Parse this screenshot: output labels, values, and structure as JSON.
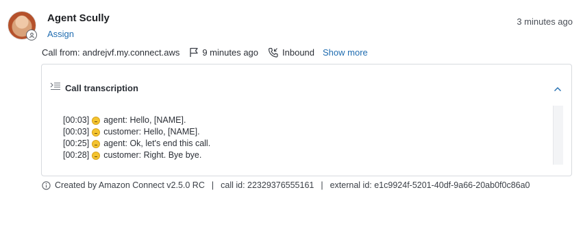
{
  "header": {
    "agent_name": "Agent Scully",
    "assign_label": "Assign",
    "time_ago": "3 minutes ago"
  },
  "meta": {
    "call_from": "Call from: andrejvf.my.connect.aws",
    "duration": "9 minutes ago",
    "direction": "Inbound",
    "show_more_label": "Show more"
  },
  "panel": {
    "title": "Call transcription",
    "lines": [
      {
        "time": "[00:03]",
        "text": "agent: Hello, [NAME]."
      },
      {
        "time": "[00:03]",
        "text": "customer: Hello, [NAME]."
      },
      {
        "time": "[00:25]",
        "text": "agent: Ok, let's end this call."
      },
      {
        "time": "[00:28]",
        "text": "customer: Right. Bye bye."
      }
    ]
  },
  "footer": {
    "created_by": "Created by Amazon Connect v2.5.0 RC",
    "call_id": "call id: 22329376555161",
    "external_id": "external id: e1c9924f-5201-40df-9a66-20ab0f0c86a0"
  },
  "colors": {
    "link": "#1f6cb0",
    "emoji": "#f4c430"
  }
}
